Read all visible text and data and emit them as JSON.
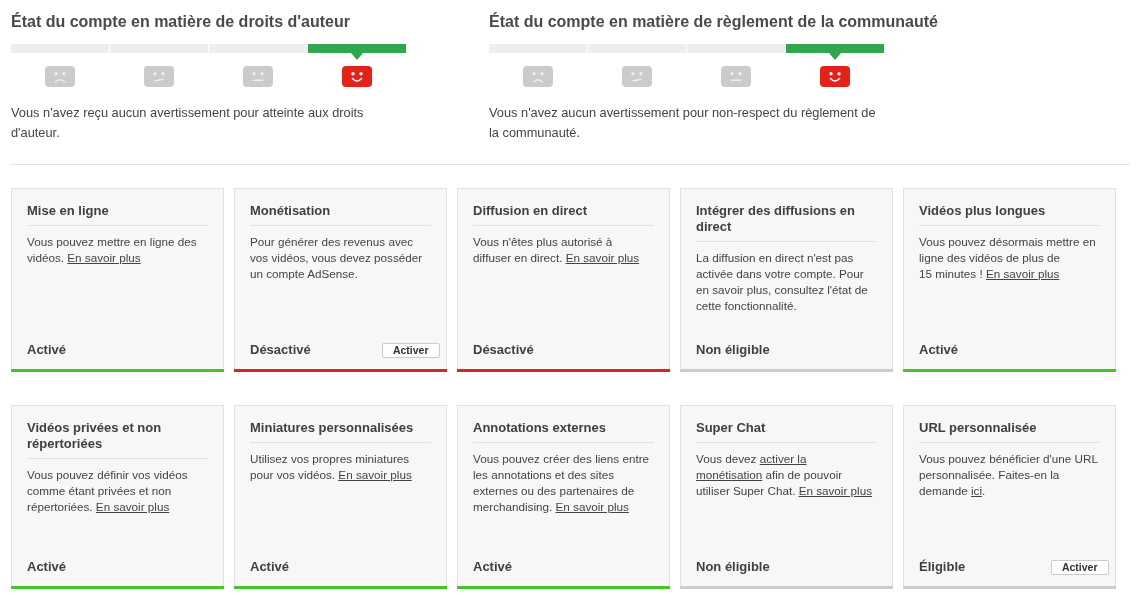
{
  "account_standing": [
    {
      "title": "État du compte en matière de droits d'auteur",
      "meter": [
        {
          "kind": "sad",
          "selected": false
        },
        {
          "kind": "unsure",
          "selected": false
        },
        {
          "kind": "neutral",
          "selected": false
        },
        {
          "kind": "happy",
          "selected": true
        }
      ],
      "description": "Vous n'avez reçu aucun avertissement pour atteinte aux droits d'auteur."
    },
    {
      "title": "État du compte en matière de règlement de la communauté",
      "meter": [
        {
          "kind": "sad",
          "selected": false
        },
        {
          "kind": "unsure",
          "selected": false
        },
        {
          "kind": "neutral",
          "selected": false
        },
        {
          "kind": "happy",
          "selected": true
        }
      ],
      "description": "Vous n'avez aucun avertissement pour non-respect du règlement de la communauté."
    }
  ],
  "features": [
    {
      "title": "Mise en ligne",
      "description": [
        {
          "kind": "text",
          "text": "Vous pouvez mettre en ligne des vidéos. "
        },
        {
          "kind": "link",
          "text": "En savoir plus"
        }
      ],
      "status": "Activé",
      "color": "#45c528"
    },
    {
      "title": "Monétisation",
      "description": [
        {
          "kind": "text",
          "text": "Pour générer des revenus avec vos vidéos, vous devez posséder un compte AdSense."
        }
      ],
      "status": "Désactivé",
      "color": "#d52a1f",
      "button": "Activer"
    },
    {
      "title": "Diffusion en direct",
      "description": [
        {
          "kind": "text",
          "text": "Vous n'êtes plus autorisé à diffuser en direct. "
        },
        {
          "kind": "link",
          "text": "En savoir plus"
        }
      ],
      "status": "Désactivé",
      "color": "#d52a1f"
    },
    {
      "title": "Intégrer des diffusions en direct",
      "description": [
        {
          "kind": "text",
          "text": "La diffusion en direct n'est pas activée dans votre compte. Pour en savoir plus, consultez l'état de cette fonctionnalité."
        }
      ],
      "status": "Non éligible",
      "color": "#cccccc"
    },
    {
      "title": "Vidéos plus longues",
      "description": [
        {
          "kind": "text",
          "text": "Vous pouvez désormais mettre en ligne des vidéos de plus de 15 minutes ! "
        },
        {
          "kind": "link",
          "text": "En savoir plus"
        }
      ],
      "status": "Activé",
      "color": "#45c528"
    },
    {
      "title": "Vidéos privées et non répertoriées",
      "description": [
        {
          "kind": "text",
          "text": "Vous pouvez définir vos vidéos comme étant privées et non répertoriées. "
        },
        {
          "kind": "link",
          "text": "En savoir plus"
        }
      ],
      "status": "Activé",
      "color": "#45c528"
    },
    {
      "title": "Miniatures personnalisées",
      "description": [
        {
          "kind": "text",
          "text": "Utilisez vos propres miniatures pour vos vidéos. "
        },
        {
          "kind": "link",
          "text": "En savoir plus"
        }
      ],
      "status": "Activé",
      "color": "#45c528"
    },
    {
      "title": "Annotations externes",
      "description": [
        {
          "kind": "text",
          "text": "Vous pouvez créer des liens entre les annotations et des sites externes ou des partenaires de merchandising. "
        },
        {
          "kind": "link",
          "text": "En savoir plus"
        }
      ],
      "status": "Activé",
      "color": "#45c528"
    },
    {
      "title": "Super Chat",
      "description": [
        {
          "kind": "text",
          "text": "Vous devez "
        },
        {
          "kind": "link",
          "text": "activer la"
        },
        {
          "kind": "link",
          "text": "monétisation"
        },
        {
          "kind": "text",
          "text": " afin de pouvoir utiliser Super Chat. "
        },
        {
          "kind": "link",
          "text": "En savoir plus"
        }
      ],
      "status": "Non éligible",
      "color": "#cccccc"
    },
    {
      "title": "URL personnalisée",
      "description": [
        {
          "kind": "text",
          "text": "Vous pouvez bénéficier d'une URL personnalisée. Faites-en la demande "
        },
        {
          "kind": "link",
          "text": "ici"
        },
        {
          "kind": "text",
          "text": "."
        }
      ],
      "status": "Éligible",
      "color": "#cccccc",
      "button": "Activer"
    }
  ]
}
